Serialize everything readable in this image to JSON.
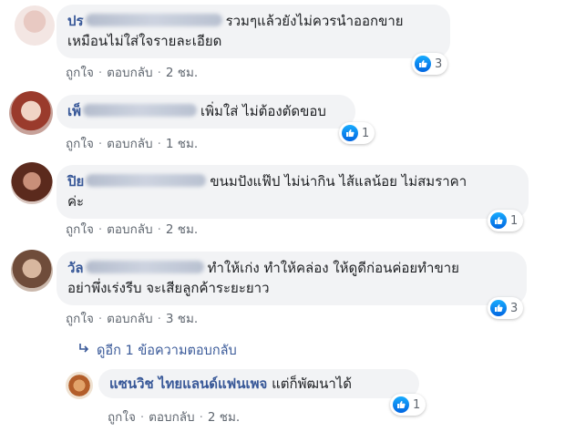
{
  "comments": [
    {
      "name_prefix": "ปร",
      "text_line1": "รวมๆแล้วยังไม่ควรนำออกขาย",
      "text_line2": "เหมือนไม่ใส่ใจรายละเอียด",
      "like_label": "ถูกใจ",
      "reply_label": "ตอบกลับ",
      "time": "2 ชม.",
      "reactions": "3"
    },
    {
      "name_prefix": "เพ็",
      "text_line1": "เพิ่มใส่ ไม่ต้องตัดขอบ",
      "like_label": "ถูกใจ",
      "reply_label": "ตอบกลับ",
      "time": "1 ชม.",
      "reactions": "1"
    },
    {
      "name_prefix": "ปิย",
      "text_line1": "ขนมปังแฟ๊ป ไม่น่ากิน ไส้แลน้อย ไม่สมราคา",
      "text_line2": "ค่ะ",
      "like_label": "ถูกใจ",
      "reply_label": "ตอบกลับ",
      "time": "2 ชม.",
      "reactions": "1"
    },
    {
      "name_prefix": "วัล",
      "text_line1": "ทำให้เก่ง ทำให้คล่อง ให้ดูดีก่อนค่อยทำขาย",
      "text_line2": "อย่าพึ่งเร่งรีบ จะเสียลูกค้าระยะยาว",
      "like_label": "ถูกใจ",
      "reply_label": "ตอบกลับ",
      "time": "3 ชม.",
      "reactions": "3"
    }
  ],
  "more_replies": "ดูอีก 1 ข้อความตอบกลับ",
  "reply": {
    "name": "แซนวิช ไทยแลนด์แฟนเพจ",
    "text": "แต่ก็พัฒนาได้",
    "like_label": "ถูกใจ",
    "reply_label": "ตอบกลับ",
    "time": "2 ชม.",
    "reactions": "1"
  },
  "separator": "·",
  "colors": {
    "link": "#385898",
    "bubble": "#f2f3f5",
    "meta": "#606770",
    "like_blue": "#1877f2"
  }
}
